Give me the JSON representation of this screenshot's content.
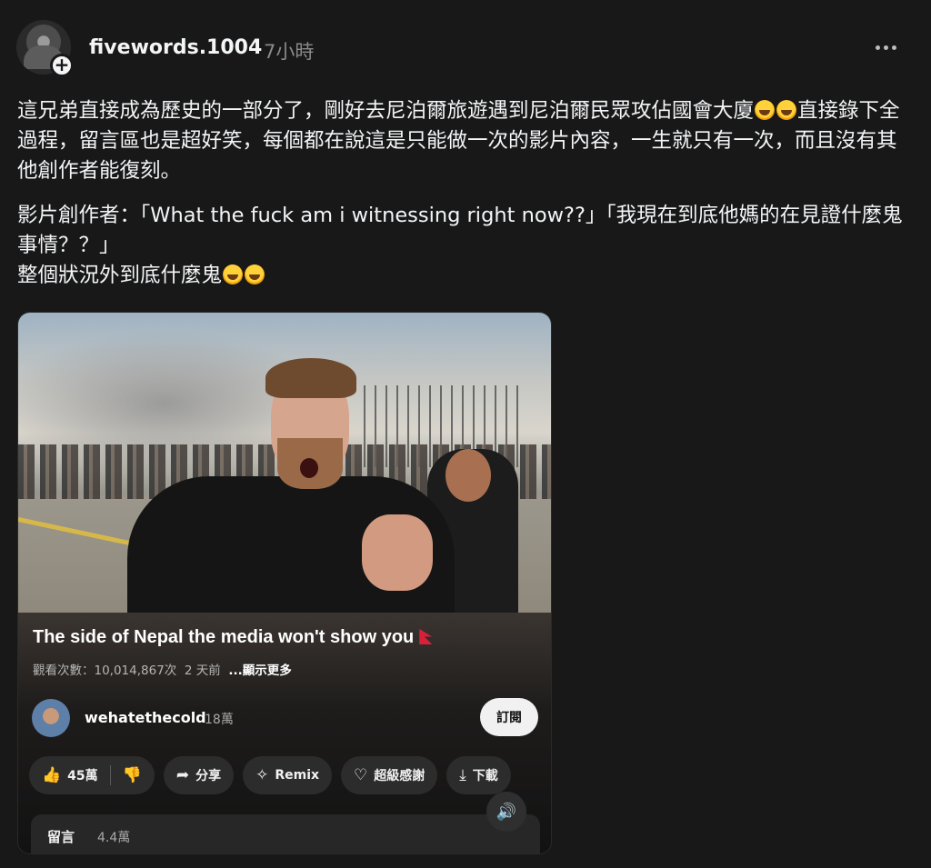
{
  "post": {
    "username": "fivewords.1004",
    "time": "7小時",
    "paragraph1": "這兄弟直接成為歷史的一部分了，剛好去尼泊爾旅遊遇到尼泊爾民眾攻佔國會大廈",
    "paragraph1b": "直接錄下全過程，留言區也是超好笑，每個都在說這是只能做一次的影片內容，一生就只有一次，而且沒有其他創作者能復刻。",
    "paragraph2": "影片創作者：「What the fuck am i witnessing right now??」「我現在到底他媽的在見證什麼鬼事情？？」",
    "paragraph3": "整個狀況外到底什麼鬼",
    "emoji_name": "rolling-on-floor-laughing"
  },
  "video": {
    "title": "The side of Nepal the media won't show you",
    "views": "觀看次數：10,014,867次",
    "age": "2 天前",
    "more": "...顯示更多",
    "channel": "wehatethecold",
    "subs": "18萬",
    "subscribe": "訂閱",
    "likes": "45萬",
    "share": "分享",
    "remix": "Remix",
    "thanks": "超級感謝",
    "download": "下載",
    "comments_label": "留言",
    "comments_count": "4.4萬"
  }
}
